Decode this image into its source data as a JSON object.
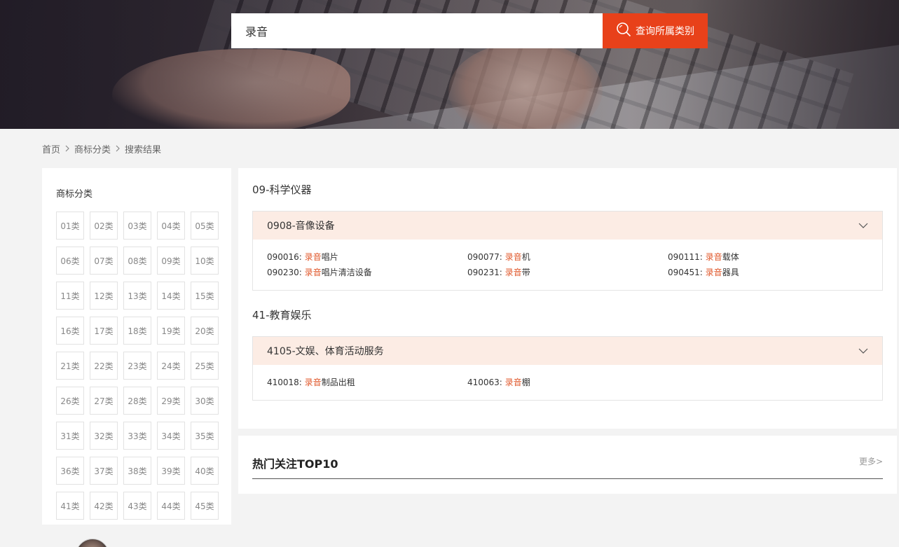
{
  "search": {
    "value": "录音",
    "button_label": "查询所属类别"
  },
  "breadcrumb": {
    "home": "首页",
    "category": "商标分类",
    "current": "搜索结果"
  },
  "sidebar": {
    "title": "商标分类",
    "classes": [
      "01类",
      "02类",
      "03类",
      "04类",
      "05类",
      "06类",
      "07类",
      "08类",
      "09类",
      "10类",
      "11类",
      "12类",
      "13类",
      "14类",
      "15类",
      "16类",
      "17类",
      "18类",
      "19类",
      "20类",
      "21类",
      "22类",
      "23类",
      "24类",
      "25类",
      "26类",
      "27类",
      "28类",
      "29类",
      "30类",
      "31类",
      "32类",
      "33类",
      "34类",
      "35类",
      "36类",
      "37类",
      "38类",
      "39类",
      "40类",
      "41类",
      "42类",
      "43类",
      "44类",
      "45类"
    ]
  },
  "results": [
    {
      "title": "09-科学仪器",
      "group": "0908-音像设备",
      "items": [
        {
          "code": "090016: ",
          "hl": "录音",
          "rest": "唱片"
        },
        {
          "code": "090077: ",
          "hl": "录音",
          "rest": "机"
        },
        {
          "code": "090111: ",
          "hl": "录音",
          "rest": "载体"
        },
        {
          "code": "090230: ",
          "hl": "录音",
          "rest": "唱片清洁设备"
        },
        {
          "code": "090231: ",
          "hl": "录音",
          "rest": "带"
        },
        {
          "code": "090451: ",
          "hl": "录音",
          "rest": "器具"
        }
      ]
    },
    {
      "title": "41-教育娱乐",
      "group": "4105-文娱、体育活动服务",
      "items": [
        {
          "code": "410018: ",
          "hl": "录音",
          "rest": "制品出租"
        },
        {
          "code": "410063: ",
          "hl": "录音",
          "rest": "棚"
        }
      ]
    }
  ],
  "hot": {
    "title": "热门关注TOP10",
    "more": "更多>"
  },
  "colors": {
    "accent": "#e8411a",
    "highlight": "#e15a2e",
    "group_bg": "#fcece4"
  },
  "icons": {
    "search": "search-icon",
    "expand": "chevron-down-icon",
    "separator": "chevron-right-icon"
  }
}
